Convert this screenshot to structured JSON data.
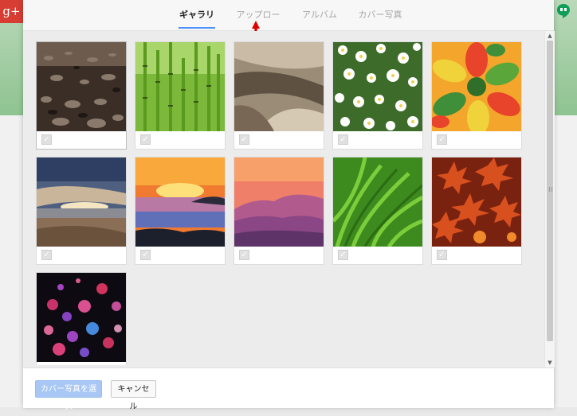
{
  "app": {
    "logo_text": "g+"
  },
  "tabs": [
    {
      "label": "ギャラリー",
      "active": true
    },
    {
      "label": "アップロード",
      "active": false
    },
    {
      "label": "アルバム",
      "active": false
    },
    {
      "label": "カバー写真",
      "active": false
    }
  ],
  "gallery": {
    "photos": [
      {
        "subject": "raindrops on dark surface"
      },
      {
        "subject": "horsetail plants"
      },
      {
        "subject": "abstract beige curves"
      },
      {
        "subject": "white daisies"
      },
      {
        "subject": "colorful petal flower"
      },
      {
        "subject": "sunset beach clouds"
      },
      {
        "subject": "orange sunset over clouds"
      },
      {
        "subject": "pink mountain ridges"
      },
      {
        "subject": "green grass blades"
      },
      {
        "subject": "red maple leaves"
      },
      {
        "subject": "bokeh lights"
      }
    ]
  },
  "footer": {
    "select_label": "カバー写真を選択",
    "cancel_label": "キャンセル"
  },
  "icons": {
    "checkmark": "check-icon",
    "arrow": "red-arrow-icon"
  },
  "colors": {
    "accent": "#4d90fe",
    "primary_button": "#a9c7f5",
    "arrow": "#dd0000",
    "gplus": "#d73d32"
  }
}
